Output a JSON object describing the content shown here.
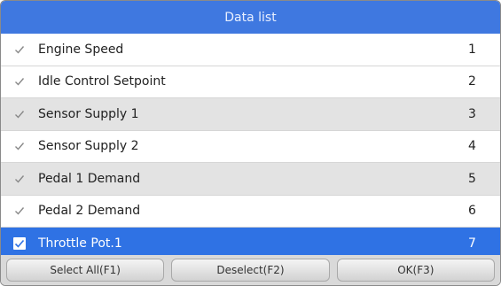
{
  "title": "Data list",
  "items": [
    {
      "label": "Engine Speed",
      "num": "1",
      "checked": true,
      "style": "white"
    },
    {
      "label": "Idle Control Setpoint",
      "num": "2",
      "checked": true,
      "style": "white"
    },
    {
      "label": "Sensor Supply 1",
      "num": "3",
      "checked": true,
      "style": "alt"
    },
    {
      "label": "Sensor Supply 2",
      "num": "4",
      "checked": true,
      "style": "white"
    },
    {
      "label": "Pedal 1 Demand",
      "num": "5",
      "checked": true,
      "style": "alt"
    },
    {
      "label": "Pedal 2 Demand",
      "num": "6",
      "checked": true,
      "style": "white"
    },
    {
      "label": "Throttle Pot.1",
      "num": "7",
      "checked": true,
      "style": "selected"
    }
  ],
  "buttons": {
    "select_all": "Select All(F1)",
    "deselect": "Deselect(F2)",
    "ok": "OK(F3)"
  },
  "colors": {
    "title_bar": "#3f78e0",
    "selected_row": "#2f72e4",
    "alt_row": "#e3e3e3",
    "button_bar": "#d9d9d9"
  },
  "icons": {
    "checkbox": "checkmark-icon"
  }
}
